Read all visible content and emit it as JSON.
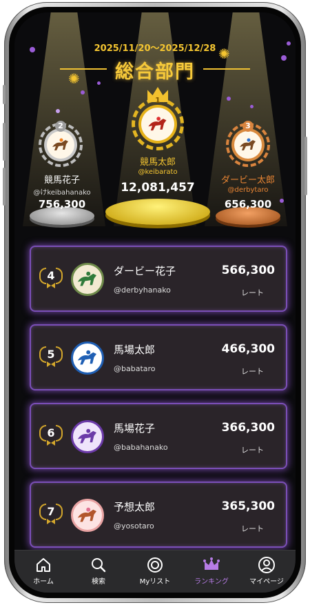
{
  "period": "2025/11/20〜2025/12/28",
  "title": "総合部門",
  "podium": [
    {
      "rank": "1",
      "name": "競馬太郎",
      "handle": "@keibarato",
      "rate": "12,081,457"
    },
    {
      "rank": "2",
      "name": "競馬花子",
      "handle": "@けkeibahanako",
      "rate": "756,300"
    },
    {
      "rank": "3",
      "name": "ダービー太郎",
      "handle": "@derbytaro",
      "rate": "656,300"
    }
  ],
  "rate_label": "レート",
  "rankings": [
    {
      "rank": "4",
      "name": "ダービー花子",
      "handle": "@derbyhanako",
      "rate": "566,300",
      "avatar_color": "#2f7a3a",
      "avatar_bg": "#f3ead2"
    },
    {
      "rank": "5",
      "name": "馬場太郎",
      "handle": "@babataro",
      "rate": "466,300",
      "avatar_color": "#1f5fb4",
      "avatar_bg": "#ffffff"
    },
    {
      "rank": "6",
      "name": "馬場花子",
      "handle": "@babahanako",
      "rate": "366,300",
      "avatar_color": "#6b3aa8",
      "avatar_bg": "#efe4fb"
    },
    {
      "rank": "7",
      "name": "予想太郎",
      "handle": "@yosotaro",
      "rate": "365,300",
      "avatar_color": "#b2552b",
      "avatar_bg": "#fde3e3"
    }
  ],
  "nav": [
    {
      "label": "ホーム",
      "icon": "home-icon"
    },
    {
      "label": "検索",
      "icon": "search-icon"
    },
    {
      "label": "Myリスト",
      "icon": "mylist-icon"
    },
    {
      "label": "ランキング",
      "icon": "crown-icon",
      "active": true
    },
    {
      "label": "マイページ",
      "icon": "user-icon"
    }
  ],
  "colors": {
    "gold": "#f4c531",
    "silver": "#b9b9b9",
    "bronze": "#d97a38",
    "accent": "#b77ce6"
  }
}
